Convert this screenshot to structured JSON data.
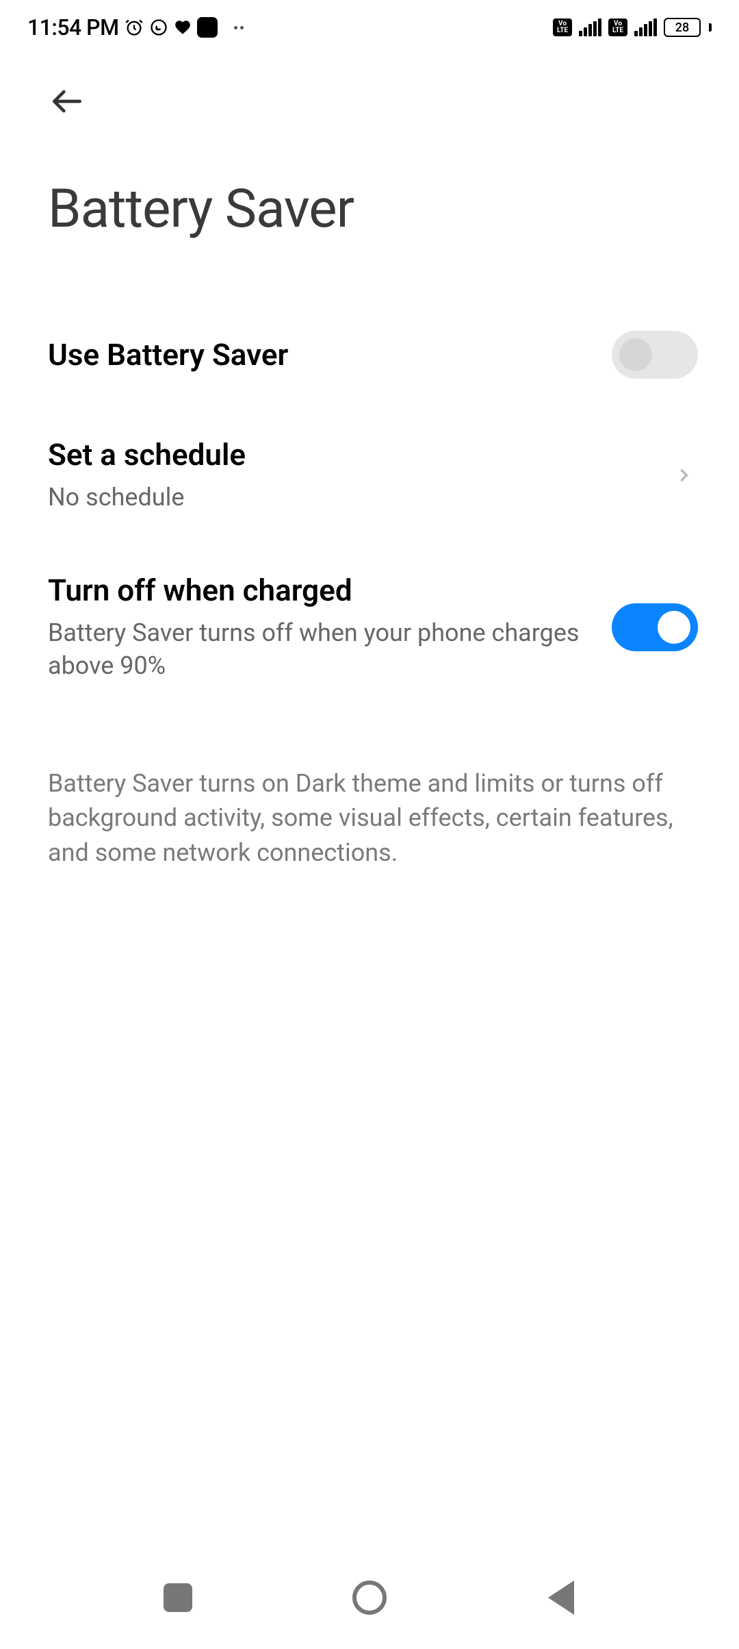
{
  "status": {
    "time": "11:54 PM",
    "battery_level": "28"
  },
  "header": {
    "title": "Battery Saver"
  },
  "settings": {
    "use_saver": {
      "title": "Use Battery Saver",
      "enabled": false
    },
    "schedule": {
      "title": "Set a schedule",
      "subtitle": "No schedule"
    },
    "turn_off_charged": {
      "title": "Turn off when charged",
      "subtitle": "Battery Saver turns off when your phone charges above 90%",
      "enabled": true
    }
  },
  "footer_info": "Battery Saver turns on Dark theme and limits or turns off background activity, some visual effects, certain features, and some network connections."
}
